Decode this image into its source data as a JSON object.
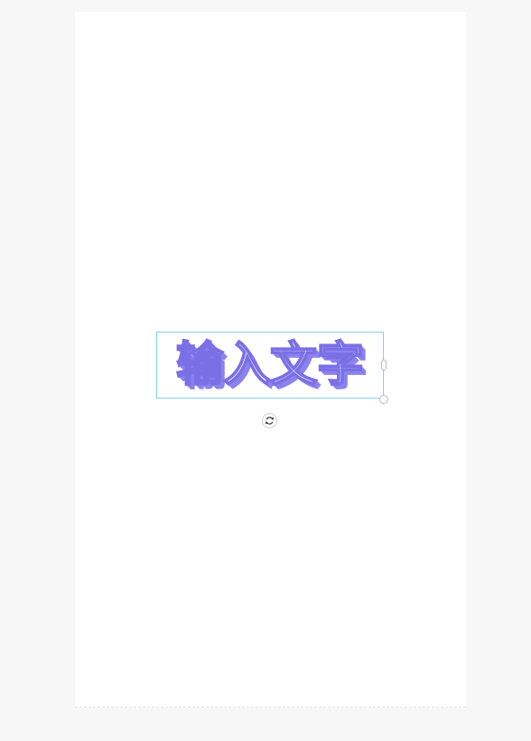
{
  "canvas": {
    "background": "#ffffff",
    "page_background": "#f7f7f7"
  },
  "text_element": {
    "content": "输入文字",
    "fill_color": "#ffffff",
    "stroke_color": "#7b6fe6",
    "shadow_color": "#8c82ee",
    "selection_border_color": "#7fd0f2"
  },
  "icons": {
    "rotate": "rotate-icon",
    "resize_side": "resize-handle-side",
    "resize_corner": "resize-handle-corner"
  }
}
